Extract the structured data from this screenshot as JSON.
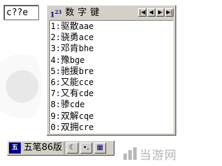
{
  "composition": {
    "text": "c??e"
  },
  "candidate_window": {
    "title": "数字键",
    "mode_icon": "number-mode-icon",
    "mode_label": "1²³",
    "nav_buttons": [
      {
        "icon": "first-page-icon",
        "glyph": "|◀"
      },
      {
        "icon": "prev-page-icon",
        "glyph": "◀"
      },
      {
        "icon": "next-page-icon",
        "glyph": "▶"
      },
      {
        "icon": "last-page-icon",
        "glyph": "▶|"
      }
    ],
    "candidates": [
      {
        "num": "1:",
        "word": "驱散",
        "code": "aae"
      },
      {
        "num": "2:",
        "word": "骁勇",
        "code": "ace"
      },
      {
        "num": "3:",
        "word": "邓肯",
        "code": "bhe"
      },
      {
        "num": "4:",
        "word": "豫",
        "code": "bge"
      },
      {
        "num": "5:",
        "word": "驰援",
        "code": "bre"
      },
      {
        "num": "6:",
        "word": "又能",
        "code": "cce"
      },
      {
        "num": "7:",
        "word": "又有",
        "code": "cde"
      },
      {
        "num": "8:",
        "word": "骖",
        "code": "cde"
      },
      {
        "num": "9:",
        "word": "双解",
        "code": "cqe"
      },
      {
        "num": "0:",
        "word": "双拥",
        "code": "cre"
      }
    ]
  },
  "status_bar": {
    "name": "五笔86版",
    "buttons": [
      {
        "icon": "moon-icon",
        "glyph": "☾"
      },
      {
        "icon": "punctuation-icon",
        "glyph": "•,"
      },
      {
        "icon": "soft-keyboard-icon",
        "glyph": "▦"
      }
    ]
  },
  "watermark": {
    "text": "当游网"
  }
}
